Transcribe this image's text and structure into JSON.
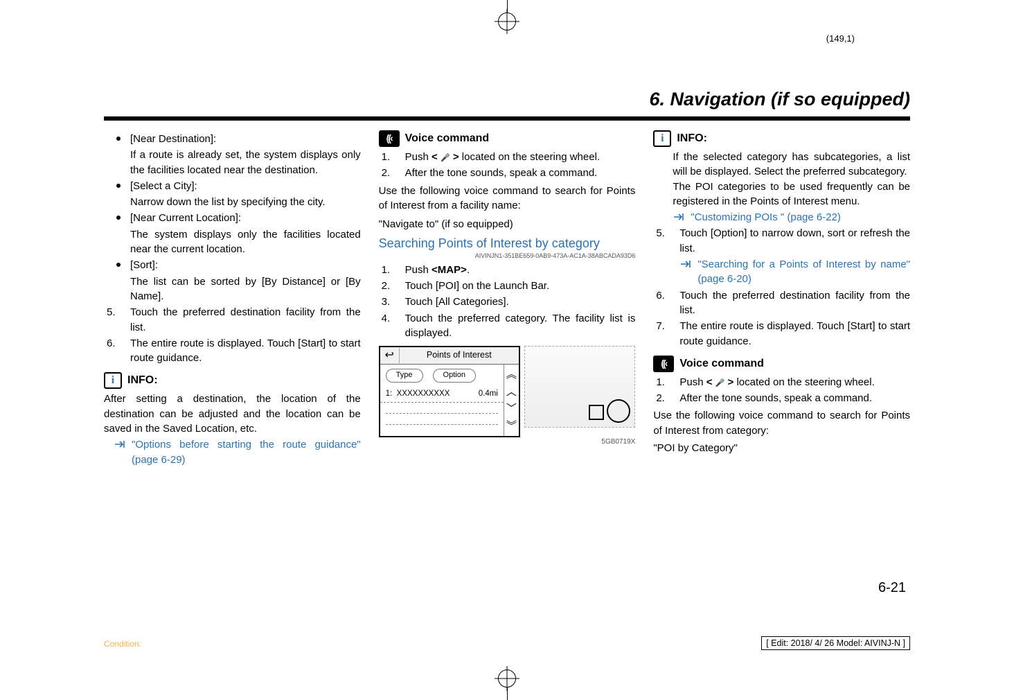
{
  "page_number_top": "(149,1)",
  "section_title": "6. Navigation (if so equipped)",
  "col1": {
    "bullets": [
      {
        "label": "[Near Destination]:",
        "body": "If a route is already set, the system displays only the facilities located near the destination."
      },
      {
        "label": "[Select a City]:",
        "body": "Narrow down the list by specifying the city."
      },
      {
        "label": "[Near Current Location]:",
        "body": "The system displays only the facilities located near the current location."
      },
      {
        "label": "[Sort]:",
        "body": "The list can be sorted by [By Distance] or [By Name]."
      }
    ],
    "ol": [
      {
        "n": "5.",
        "t": "Touch the preferred destination facility from the list."
      },
      {
        "n": "6.",
        "t": "The entire route is displayed. Touch [Start] to start route guidance."
      }
    ],
    "info_label": "INFO:",
    "info_body": "After setting a destination, the location of the destination can be adjusted and the location can be saved in the Saved Location, etc.",
    "info_link": "\"Options before starting the route guidance\" (page 6-29)"
  },
  "col2": {
    "voice_label": "Voice command",
    "voice_ol": [
      {
        "n": "1.",
        "pre": "Push ",
        "bold": "< ",
        "mic": "🎤",
        "bold2": " >",
        "post": " located on the steering wheel."
      },
      {
        "n": "2.",
        "t": "After the tone sounds, speak a command."
      }
    ],
    "voice_body": "Use the following voice command to search for Points of Interest from a facility name:",
    "voice_phrase": "\"Navigate to\" (if so equipped)",
    "subheading": "Searching Points of Interest by category",
    "guid": "AIVINJN1-351BE659-0AB9-473A-AC1A-38ABCADA93D6",
    "ol2": [
      {
        "n": "1.",
        "pre": "Push ",
        "bold": "<MAP>",
        "post": "."
      },
      {
        "n": "2.",
        "t": "Touch [POI] on the Launch Bar."
      },
      {
        "n": "3.",
        "t": "Touch [All Categories]."
      },
      {
        "n": "4.",
        "t": "Touch the preferred category. The facility list is displayed."
      }
    ],
    "poi_title": "Points of Interest",
    "poi_type": "Type",
    "poi_option": "Option",
    "poi_row_name": "XXXXXXXXXX",
    "poi_row_idx": "1:",
    "poi_row_dist": "0.4mi",
    "img_label": "5GB0719X"
  },
  "col3": {
    "info_label": "INFO:",
    "info_body1": "If the selected category has subcategories, a list will be displayed. Select the preferred subcategory.",
    "info_body2": "The POI categories to be used frequently can be registered in the Points of Interest menu.",
    "info_link1": "\"Customizing POIs \" (page 6-22)",
    "ol": [
      {
        "n": "5.",
        "t": "Touch [Option] to narrow down, sort or refresh the list.",
        "link": "\"Searching for a Points of Interest by name\" (page 6-20)"
      },
      {
        "n": "6.",
        "t": "Touch the preferred destination facility from the list."
      },
      {
        "n": "7.",
        "t": "The entire route is displayed. Touch [Start] to start route guidance."
      }
    ],
    "voice_label": "Voice command",
    "voice_ol": [
      {
        "n": "1.",
        "pre": "Push ",
        "bold": "< ",
        "mic": "🎤",
        "bold2": " >",
        "post": " located on the steering wheel."
      },
      {
        "n": "2.",
        "t": "After the tone sounds, speak a command."
      }
    ],
    "voice_body": "Use the following voice command to search for Points of Interest from category:",
    "voice_phrase": "\"POI by Category\""
  },
  "page_number": "6-21",
  "footer_left": "Condition:",
  "footer_right": "[ Edit: 2018/ 4/ 26    Model:  AIVINJ-N ]"
}
